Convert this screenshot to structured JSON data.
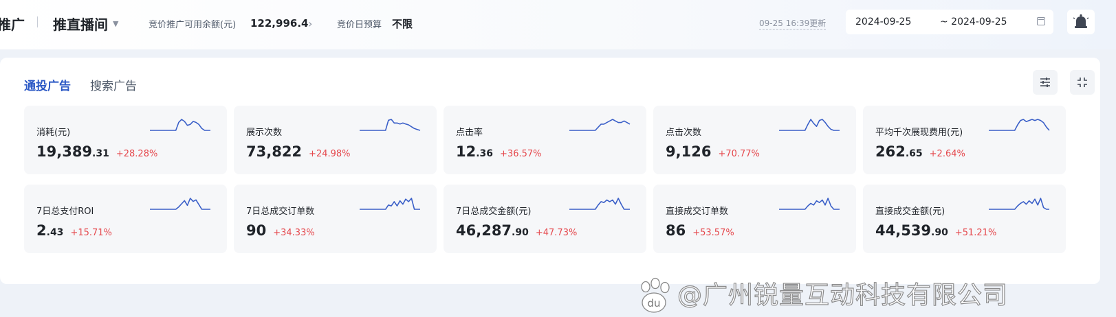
{
  "topbar": {
    "brand_partial": "推广",
    "mode": "推直播间",
    "balance_label": "竞价推广可用余额(元)",
    "balance_value": "122,996.4",
    "budget_label": "竞价日预算",
    "budget_value": "不限",
    "update_time": "09-25 16:39更新",
    "date_start": "2024-09-25",
    "date_end": "~ 2024-09-25"
  },
  "tabs": [
    {
      "label": "通投广告",
      "active": true
    },
    {
      "label": "搜索广告",
      "active": false
    }
  ],
  "metrics": [
    {
      "title": "消耗(元)",
      "int": "19,389",
      "dec": ".31",
      "change": "+28.28%",
      "trend": [
        0,
        0,
        0,
        0,
        0,
        0,
        0,
        0,
        0,
        0,
        8,
        11,
        9,
        5,
        6,
        9,
        8,
        6,
        2,
        0,
        0,
        0
      ]
    },
    {
      "title": "展示次数",
      "int": "73,822",
      "dec": "",
      "change": "+24.98%",
      "trend": [
        0,
        0,
        0,
        0,
        0,
        0,
        0,
        0,
        0,
        0,
        11,
        12,
        8,
        8,
        7,
        8,
        7,
        6,
        4,
        2,
        1,
        0
      ]
    },
    {
      "title": "点击率",
      "int": "12",
      "dec": ".36",
      "change": "+36.57%",
      "trend": [
        0,
        0,
        0,
        0,
        0,
        0,
        0,
        0,
        0,
        0,
        2,
        4,
        4,
        5,
        6,
        7,
        6,
        5,
        5,
        6,
        5,
        4
      ]
    },
    {
      "title": "点击次数",
      "int": "9,126",
      "dec": "",
      "change": "+70.77%",
      "trend": [
        0,
        0,
        0,
        0,
        0,
        0,
        0,
        0,
        0,
        0,
        6,
        11,
        7,
        4,
        10,
        11,
        8,
        4,
        1,
        0,
        0,
        0
      ]
    },
    {
      "title": "平均千次展现费用(元)",
      "int": "262",
      "dec": ".65",
      "change": "+2.64%",
      "trend": [
        0,
        0,
        0,
        0,
        0,
        0,
        0,
        0,
        0,
        0,
        5,
        9,
        10,
        8,
        9,
        10,
        9,
        10,
        9,
        7,
        3,
        0
      ]
    },
    {
      "title": "7日总支付ROI",
      "int": "2",
      "dec": ".43",
      "change": "+15.71%",
      "trend": [
        0,
        0,
        0,
        0,
        0,
        0,
        0,
        0,
        0,
        0,
        3,
        7,
        11,
        5,
        14,
        10,
        12,
        6,
        0,
        0,
        0,
        0
      ]
    },
    {
      "title": "7日总成交订单数",
      "int": "90",
      "dec": "",
      "change": "+34.33%",
      "trend": [
        0,
        0,
        0,
        0,
        0,
        0,
        0,
        0,
        0,
        0,
        5,
        4,
        9,
        4,
        10,
        6,
        12,
        9,
        13,
        0,
        0,
        0
      ]
    },
    {
      "title": "7日总成交金额(元)",
      "int": "46,287",
      "dec": ".90",
      "change": "+47.73%",
      "trend": [
        0,
        0,
        0,
        0,
        0,
        0,
        0,
        0,
        0,
        0,
        5,
        9,
        8,
        11,
        9,
        11,
        6,
        13,
        6,
        0,
        0,
        0
      ]
    },
    {
      "title": "直接成交订单数",
      "int": "86",
      "dec": "",
      "change": "+53.57%",
      "trend": [
        0,
        0,
        0,
        0,
        0,
        0,
        0,
        0,
        0,
        0,
        4,
        7,
        5,
        10,
        8,
        11,
        5,
        13,
        4,
        0,
        0,
        0
      ]
    },
    {
      "title": "直接成交金额(元)",
      "int": "44,539",
      "dec": ".90",
      "change": "+51.21%",
      "trend": [
        0,
        0,
        0,
        0,
        0,
        0,
        0,
        0,
        0,
        0,
        4,
        7,
        9,
        6,
        10,
        7,
        12,
        5,
        13,
        2,
        0,
        0
      ]
    }
  ],
  "watermark": {
    "text": "@广州锐量互动科技有限公司",
    "logo": "du"
  },
  "colors": {
    "accent": "#2c59c5",
    "sparkline": "#3a5fc8",
    "increase": "#e5484d"
  },
  "icons": {
    "mode_caret": "caret-down-icon",
    "balance_arrow": "chevron-right-icon",
    "calendar": "calendar-icon",
    "notify": "bell-icon",
    "filter": "filter-sliders-icon",
    "collapse": "collapse-icon"
  }
}
